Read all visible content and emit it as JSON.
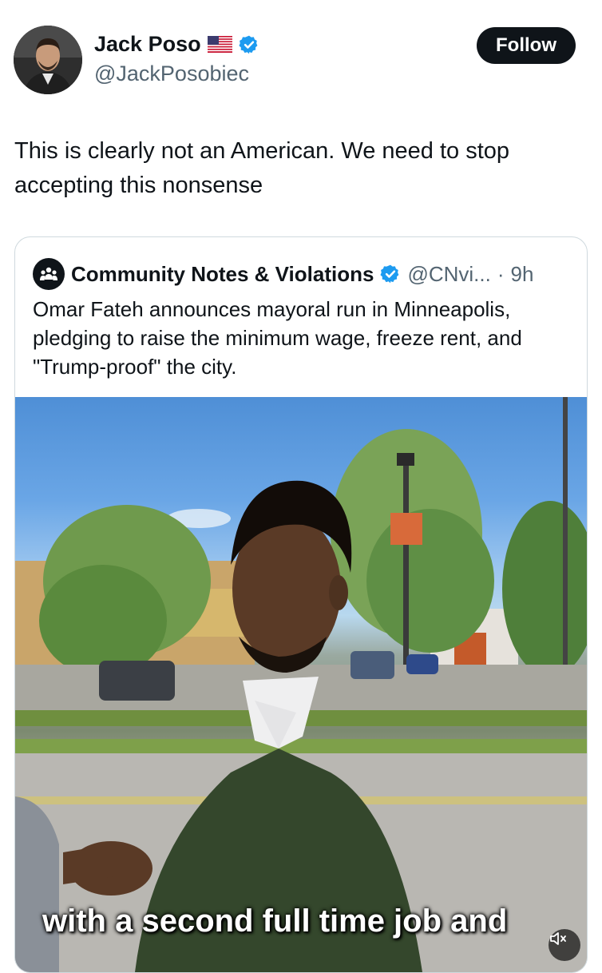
{
  "tweet": {
    "author_name": "Jack Poso",
    "author_handle": "@JackPosobiec",
    "flag_icon": "us-flag-icon",
    "verified_color": "#1d9bf0",
    "follow_label": "Follow",
    "text": "This is clearly not an American. We need to stop accepting this nonsense"
  },
  "quoted": {
    "author_name": "Community Notes & Violations",
    "author_handle": "@CNvi...",
    "separator": "·",
    "time": "9h",
    "text": "Omar Fateh announces mayoral run in Minneapolis, pledging to raise the minimum wage, freeze rent, and \"Trump-proof\" the city.",
    "media": {
      "caption": "with a second full time job and",
      "mute_icon": "speaker-muted-icon"
    }
  }
}
